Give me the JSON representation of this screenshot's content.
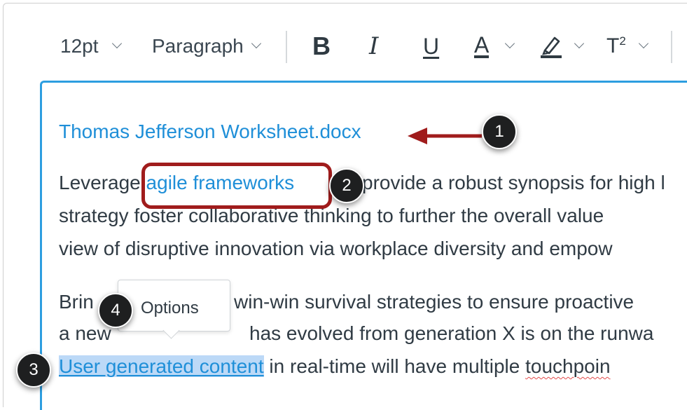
{
  "toolbar": {
    "font_size": "12pt",
    "block_format": "Paragraph",
    "bold_label": "B",
    "italic_label": "I",
    "underline_label": "U",
    "text_color_label": "A",
    "superscript_label": "T",
    "superscript_exponent": "2"
  },
  "editor": {
    "file_link": "Thomas Jefferson Worksheet.docx",
    "p1": {
      "line1_before": "Leverage ",
      "link": "agile frameworks",
      "line1_after": "provide a robust synopsis for high l",
      "line2": "strategy foster collaborative thinking to further the overall value",
      "line3": "view of disruptive innovation via workplace diversity and empow"
    },
    "p2": {
      "line1_start": "Brin",
      "line1_after": "win-win survival strategies to ensure proactive",
      "line2_start": "a new",
      "line2_after": "has evolved from generation X is on the runwa",
      "selected_link": "User generated content",
      "line3_mid": " in real-time will have multiple ",
      "misspelled": "touchpoin"
    }
  },
  "popover": {
    "label": "Options"
  },
  "callouts": [
    "1",
    "2",
    "3",
    "4"
  ],
  "colors": {
    "accent": "#2d9ee0",
    "link": "#1f8fd8",
    "annotation": "#a01c1c",
    "selection": "#bcd9f7"
  }
}
